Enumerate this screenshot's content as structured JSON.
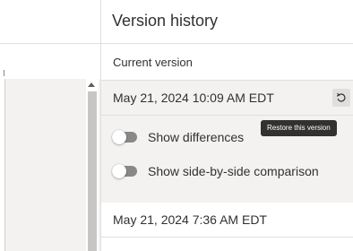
{
  "panel": {
    "title": "Version history",
    "current_section_label": "Current version"
  },
  "current_version": {
    "date": "May 21, 2024 10:09 AM EDT",
    "restore_icon": "restore-icon",
    "restore_tooltip": "Restore this version",
    "options": [
      {
        "label": "Show differences",
        "enabled": false
      },
      {
        "label": "Show side-by-side comparison",
        "enabled": false
      }
    ]
  },
  "versions": [
    {
      "date": "May 21, 2024 7:36 AM EDT"
    }
  ],
  "colors": {
    "panel_bg": "#ffffff",
    "card_bg": "#f3f2f1",
    "tooltip_bg": "#323130",
    "toggle_off": "#8a8886",
    "text": "#323130"
  }
}
